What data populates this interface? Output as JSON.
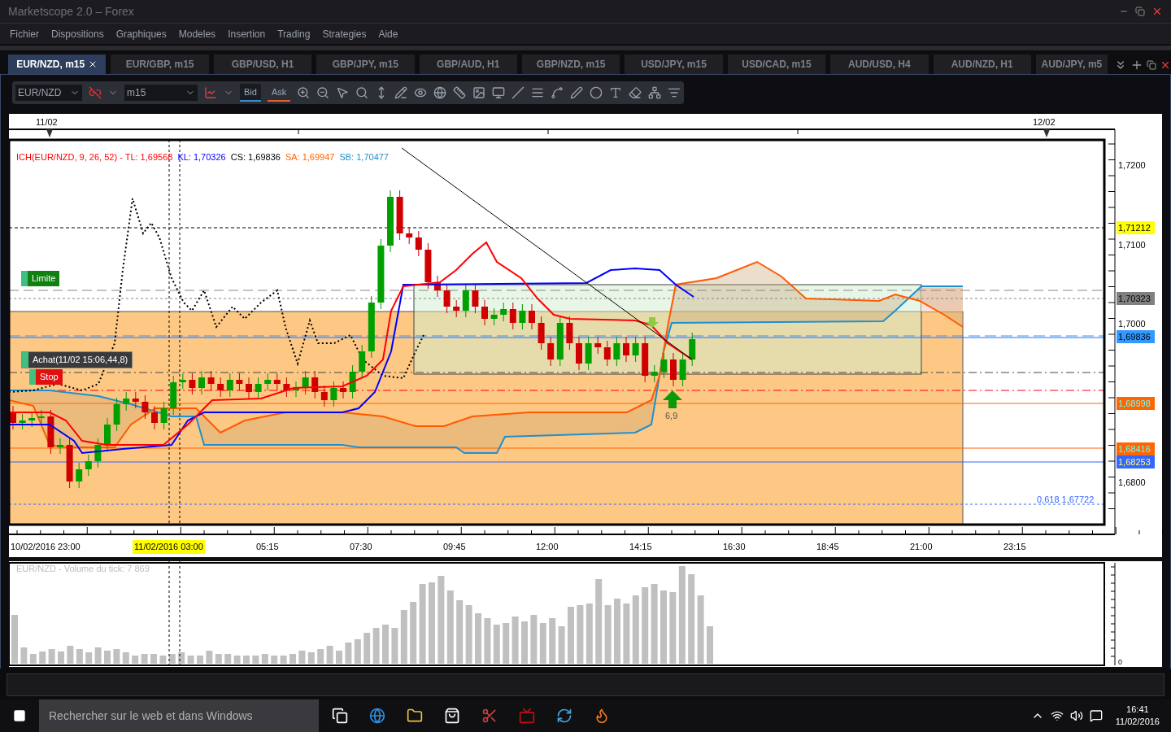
{
  "window": {
    "title": "Marketscope 2.0 – Forex"
  },
  "menu": [
    "Fichier",
    "Dispositions",
    "Graphiques",
    "Modeles",
    "Insertion",
    "Trading",
    "Strategies",
    "Aide"
  ],
  "tabs": [
    {
      "label": "EUR/NZD, m15",
      "selected": true
    },
    {
      "label": "EUR/GBP, m15",
      "selected": false
    },
    {
      "label": "GBP/USD, H1",
      "selected": false
    },
    {
      "label": "GBP/JPY, m15",
      "selected": false
    },
    {
      "label": "GBP/AUD, H1",
      "selected": false
    },
    {
      "label": "GBP/NZD, m15",
      "selected": false
    },
    {
      "label": "USD/JPY, m15",
      "selected": false
    },
    {
      "label": "USD/CAD, m15",
      "selected": false
    },
    {
      "label": "AUD/USD, H4",
      "selected": false
    },
    {
      "label": "AUD/NZD, H1",
      "selected": false
    },
    {
      "label": "AUD/JPY, m5",
      "selected": false
    }
  ],
  "toolbar": {
    "symbol": "EUR/NZD",
    "timeframe": "m15",
    "price_buttons": [
      {
        "label": "Bid",
        "selected": true
      },
      {
        "label": "Ask",
        "selected": false
      }
    ]
  },
  "chart": {
    "dates": [
      "11/02",
      "12/02"
    ],
    "legend": [
      {
        "text": "ICH(EUR/NZD, 9, 26, 52) -  TL: 1,69568",
        "color": "#ff0000"
      },
      {
        "text": "KL: 1,70326",
        "color": "#0000ff"
      },
      {
        "text": "CS: 1,69836",
        "color": "#000000"
      },
      {
        "text": "SA: 1,69947",
        "color": "#ff6600"
      },
      {
        "text": "SB: 1,70477",
        "color": "#1e90d0"
      }
    ],
    "orders": [
      {
        "kind": "limit",
        "label": "Limite"
      },
      {
        "kind": "entry",
        "label": "Achat(11/02 15:06,44,8)"
      },
      {
        "kind": "stop",
        "label": "Stop"
      }
    ],
    "signal_label": "6,9",
    "fib_label": "0,618 1,67722",
    "price_axis": [
      {
        "label": "1,7200",
        "kind": "tick"
      },
      {
        "label": "1,71212",
        "kind": "marker",
        "color": "#ffff00"
      },
      {
        "label": "1,7100",
        "kind": "tick"
      },
      {
        "label": "1,70323",
        "kind": "marker",
        "color": "#808080"
      },
      {
        "label": "1,7000",
        "kind": "tick"
      },
      {
        "label": "1,69836",
        "kind": "marker",
        "color": "#3399ff"
      },
      {
        "label": "1,68998",
        "kind": "level",
        "color": "#ff6600"
      },
      {
        "label": "1,68416",
        "kind": "level",
        "color": "#ff6600"
      },
      {
        "label": "1,68253",
        "kind": "target",
        "color": "#3366ff"
      },
      {
        "label": "1,6800",
        "kind": "tick"
      }
    ],
    "time_axis": [
      {
        "label": "10/02/2016 23:00",
        "selected": false
      },
      {
        "label": "11/02/2016 03:00",
        "selected": true
      },
      {
        "label": "05:15",
        "selected": false
      },
      {
        "label": "07:30",
        "selected": false
      },
      {
        "label": "09:45",
        "selected": false
      },
      {
        "label": "12:00",
        "selected": false
      },
      {
        "label": "14:15",
        "selected": false
      },
      {
        "label": "16:30",
        "selected": false
      },
      {
        "label": "18:45",
        "selected": false
      },
      {
        "label": "21:00",
        "selected": false
      },
      {
        "label": "23:15",
        "selected": false
      }
    ]
  },
  "volume": {
    "title": "EUR/NZD - Volume du tick: 7 869",
    "axis_label": "0"
  },
  "taskbar": {
    "search_placeholder": "Rechercher sur le web et dans Windows",
    "time": "16:41",
    "date": "11/02/2016"
  }
}
